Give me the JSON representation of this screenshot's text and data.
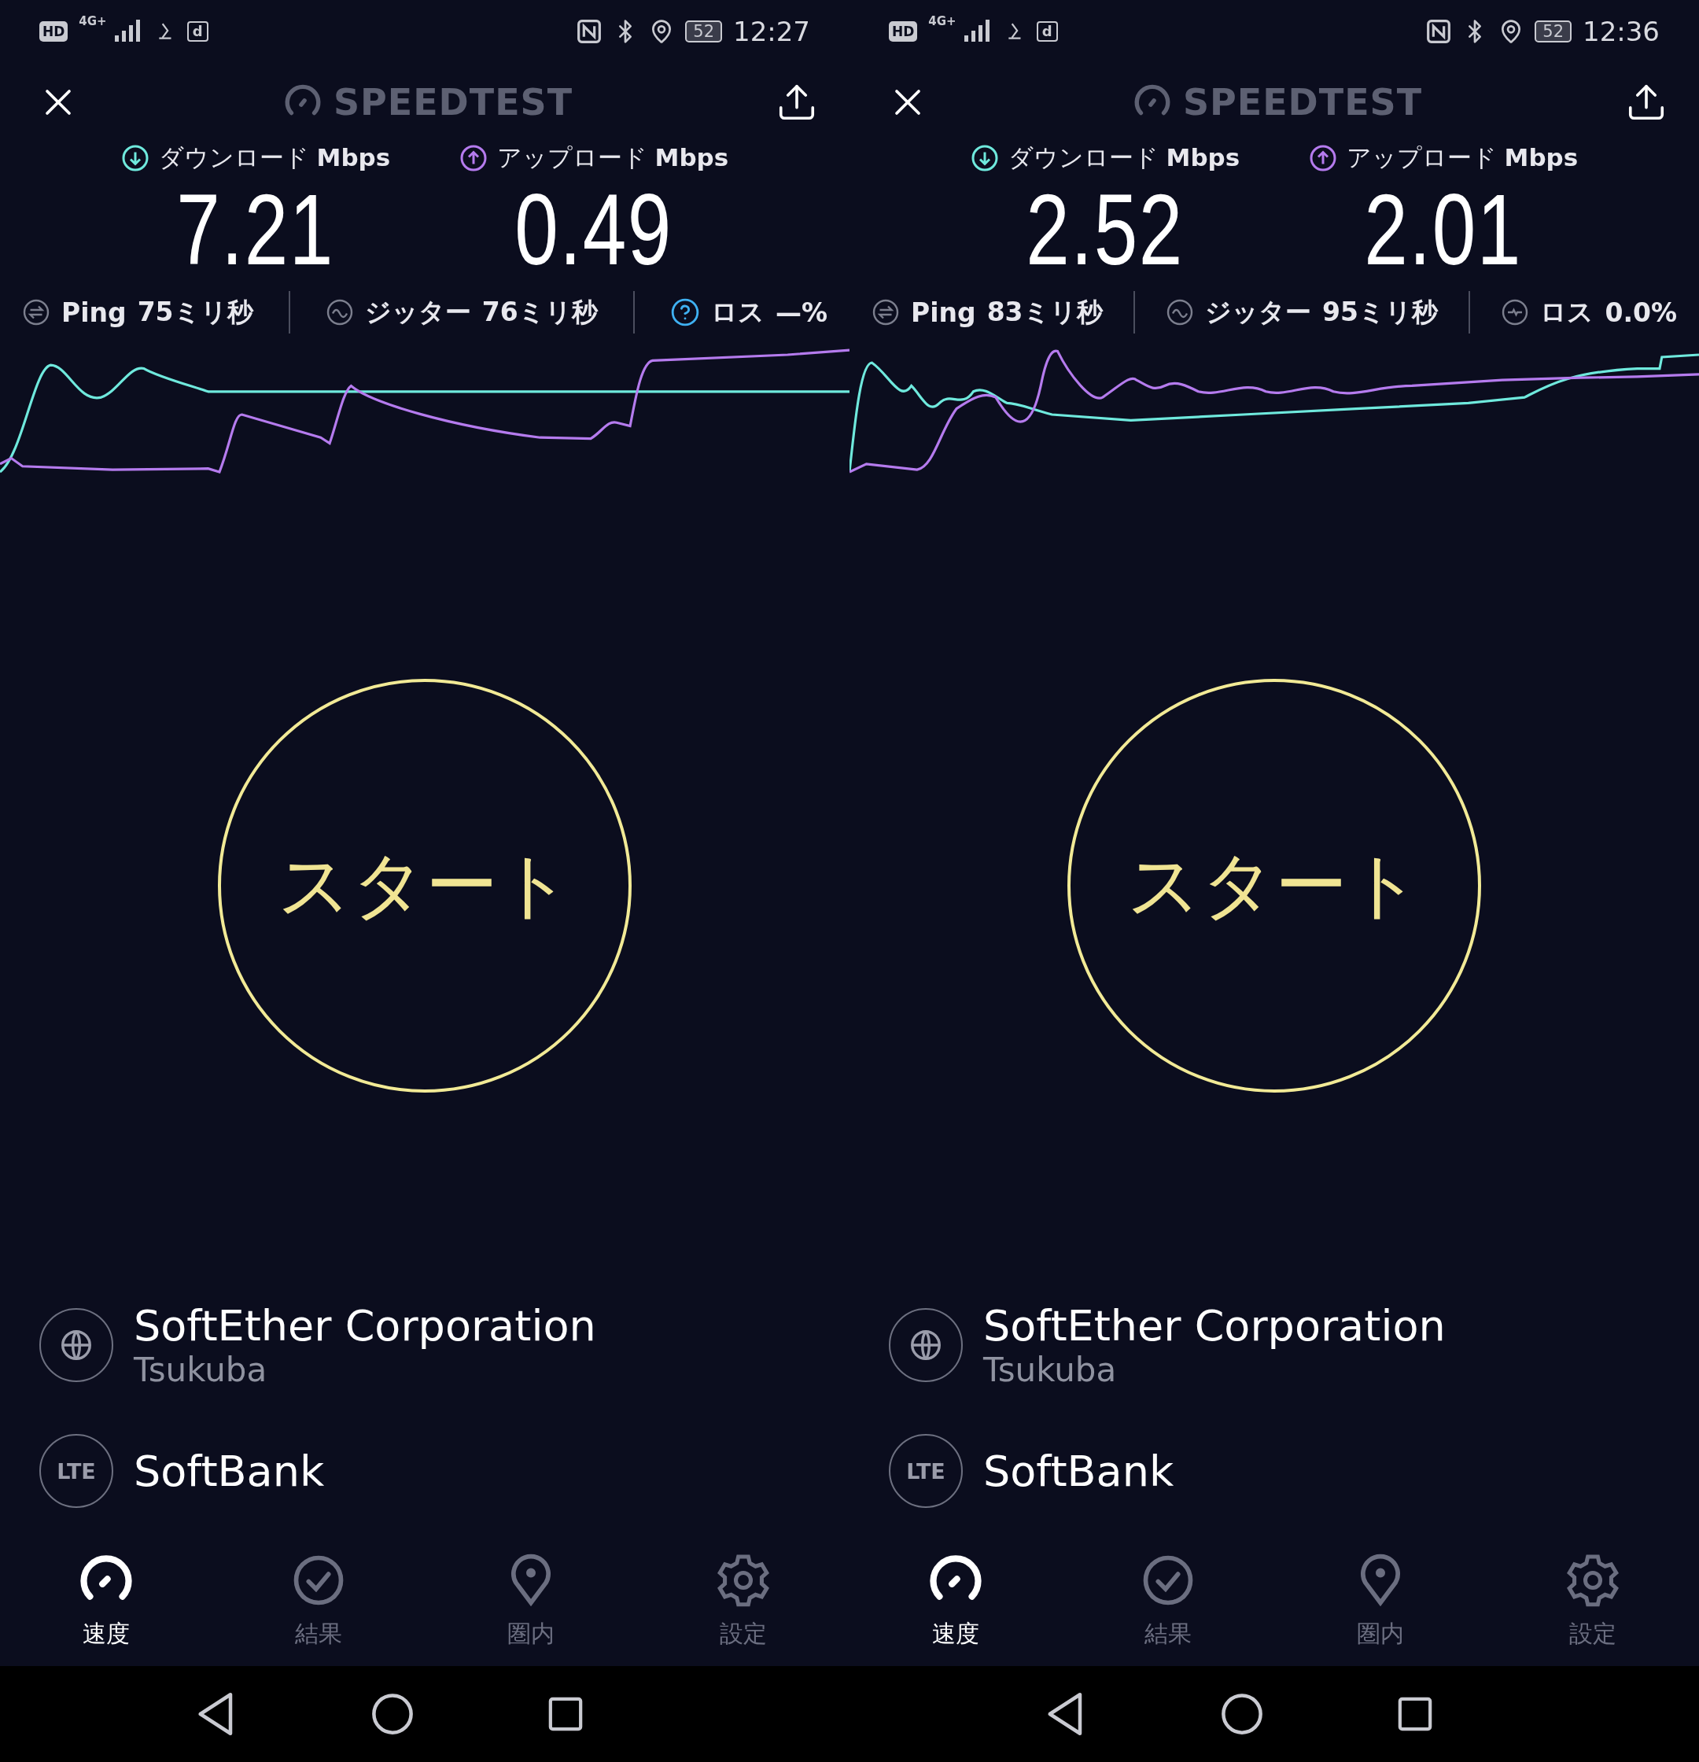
{
  "phones": [
    {
      "status_bar": {
        "hd": "HD",
        "network": "4G+",
        "notification": "d",
        "battery": "52",
        "time": "12:27"
      },
      "title": "SPEEDTEST",
      "results": [
        {
          "kind": "download",
          "label": "ダウンロード **Mbps**",
          "value": "7.21"
        },
        {
          "kind": "upload",
          "label": "アップロード **Mbps**",
          "value": "0.49"
        }
      ],
      "stats": [
        {
          "kind": "ping",
          "label": "Ping",
          "value": "75ミリ秒"
        },
        {
          "kind": "jitter",
          "label": "ジッター",
          "value": "76ミリ秒"
        },
        {
          "kind": "loss_unknown",
          "label": "ロス",
          "value": "—%"
        }
      ],
      "start_button": "スタート",
      "server": {
        "name": "SoftEther Corporation",
        "location": "Tsukuba"
      },
      "carrier": {
        "badge": "LTE",
        "name": "SoftBank"
      },
      "nav": [
        {
          "kind": "speed",
          "label": "速度",
          "selected": true
        },
        {
          "kind": "results",
          "label": "結果",
          "selected": false
        },
        {
          "kind": "coverage",
          "label": "圏内",
          "selected": false
        },
        {
          "kind": "settings",
          "label": "設定",
          "selected": false
        }
      ]
    },
    {
      "status_bar": {
        "hd": "HD",
        "network": "4G+",
        "notification": "d",
        "battery": "52",
        "time": "12:36"
      },
      "title": "SPEEDTEST",
      "results": [
        {
          "kind": "download",
          "label": "ダウンロード **Mbps**",
          "value": "2.52"
        },
        {
          "kind": "upload",
          "label": "アップロード **Mbps**",
          "value": "2.01"
        }
      ],
      "stats": [
        {
          "kind": "ping",
          "label": "Ping",
          "value": "83ミリ秒"
        },
        {
          "kind": "jitter",
          "label": "ジッター",
          "value": "95ミリ秒"
        },
        {
          "kind": "loss",
          "label": "ロス",
          "value": "0.0%"
        }
      ],
      "start_button": "スタート",
      "server": {
        "name": "SoftEther Corporation",
        "location": "Tsukuba"
      },
      "carrier": {
        "badge": "LTE",
        "name": "SoftBank"
      },
      "nav": [
        {
          "kind": "speed",
          "label": "速度",
          "selected": true
        },
        {
          "kind": "results",
          "label": "結果",
          "selected": false
        },
        {
          "kind": "coverage",
          "label": "圏内",
          "selected": false
        },
        {
          "kind": "settings",
          "label": "設定",
          "selected": false
        }
      ]
    }
  ]
}
